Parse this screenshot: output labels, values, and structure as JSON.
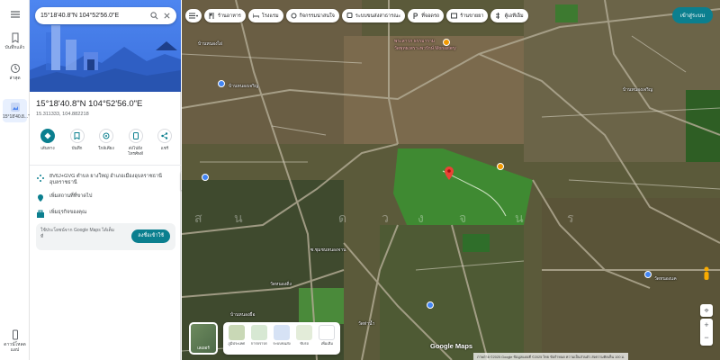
{
  "rail": {
    "saved_label": "บันทึกแล้ว",
    "recent_label": "ล่าสุด",
    "recent_item_label": "15°18'40.8...\"N...",
    "download_label": "ดาวน์โหลดแอป"
  },
  "search": {
    "value": "15°18'40.8\"N 104°52'56.0\"E"
  },
  "place": {
    "title": "15°18'40.8\"N 104°52'56.0\"E",
    "decimal": "15.311333, 104.882218"
  },
  "actions": [
    {
      "label": "เส้นทาง",
      "icon": "directions-icon"
    },
    {
      "label": "บันทึก",
      "icon": "bookmark-icon"
    },
    {
      "label": "ใกล้เคียง",
      "icon": "nearby-icon"
    },
    {
      "label": "ส่งไปยังโทรศัพท์",
      "icon": "phone-icon"
    },
    {
      "label": "แชร์",
      "icon": "share-icon"
    }
  ],
  "info": {
    "pluscode": "8V6J+GVG ตำบล ยางใหญ่ อำเภอเมืองอุบลราชธานี อุบลราชธานี",
    "add_place": "เพิ่มสถานที่ที่ขาดไป",
    "add_business": "เพิ่มธุรกิจของคุณ"
  },
  "login": {
    "text": "ใช้ประโยชน์จาก Google Maps ได้เต็มที่",
    "button": "ลงชื่อเข้าใช้"
  },
  "chips": [
    {
      "label": "ร้านอาหาร",
      "icon": "restaurant-icon"
    },
    {
      "label": "โรงแรม",
      "icon": "hotel-icon"
    },
    {
      "label": "กิจกรรมน่าสนใจ",
      "icon": "attraction-icon"
    },
    {
      "label": "ระบบขนส่งสาธารณะ",
      "icon": "transit-icon"
    },
    {
      "label": "ที่จอดรถ",
      "icon": "parking-icon"
    },
    {
      "label": "ร้านขายยา",
      "icon": "pharmacy-icon"
    },
    {
      "label": "ตู้เอทีเอ็ม",
      "icon": "atm-icon"
    }
  ],
  "signin": "เข้าสู่ระบบ",
  "map_labels": [
    {
      "text": "พระสาวก ธรรมาราม",
      "kind": "orange"
    },
    {
      "text": "วัดพุทธเพราะพวรักษ์ Monastery",
      "kind": "orange"
    },
    {
      "text": "บ้านหนองเจริญ",
      "kind": "white"
    },
    {
      "text": "บ้านหนองไผ่",
      "kind": "white"
    },
    {
      "text": "ซ.ชุมชนหนองจาน",
      "kind": "white"
    },
    {
      "text": "บ้านหนองเจริญ",
      "kind": "white"
    },
    {
      "text": "วัดหนองดิ่ง",
      "kind": "white"
    },
    {
      "text": "บ้านหนองผือ",
      "kind": "white"
    },
    {
      "text": "วัดท่าน้ำ",
      "kind": "white"
    },
    {
      "text": "วัดหนองแค",
      "kind": "white"
    }
  ],
  "watermark": [
    "ส",
    "น",
    "ด",
    "ว",
    "ง",
    "จ",
    "น",
    "ร"
  ],
  "layers": {
    "thumb_label": "เลเยอร์",
    "items": [
      "ภูมิประเทศ",
      "การจราจร",
      "ระบบขนส่ง",
      "ขับรถ",
      "เพิ่มเติม"
    ]
  },
  "brand": "Google Maps",
  "attribution": "ภาพถ่าย ©2025 Google ข้อมูลแผนที่ ©2025   ไทย   ข้อกำหนด   ความเป็นส่วนตัว   ส่งความคิดเห็น   100 ม.",
  "colors": {
    "accent": "#0b7f8f",
    "pin": "#ea4335",
    "hero": "#3a6fdc"
  }
}
